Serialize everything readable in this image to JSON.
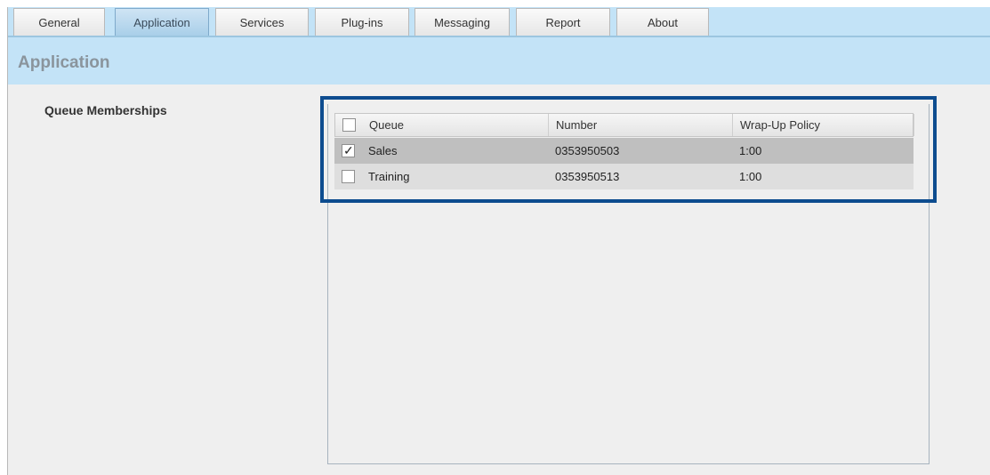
{
  "tabs": [
    {
      "label": "General"
    },
    {
      "label": "Application"
    },
    {
      "label": "Services"
    },
    {
      "label": "Plug-ins"
    },
    {
      "label": "Messaging"
    },
    {
      "label": "Report"
    },
    {
      "label": "About"
    }
  ],
  "active_tab": "Application",
  "header": {
    "title": "Application"
  },
  "queue_section": {
    "label": "Queue Memberships"
  },
  "table": {
    "columns": [
      "Queue",
      "Number",
      "Wrap-Up Policy"
    ],
    "select_all_checked": false,
    "rows": [
      {
        "checked": true,
        "queue": "Sales",
        "number": "0353950503",
        "wrapup": "1:00",
        "check_glyph": "✓"
      },
      {
        "checked": false,
        "queue": "Training",
        "number": "0353950513",
        "wrapup": "1:00",
        "check_glyph": ""
      }
    ]
  },
  "colors": {
    "tabbar_bg": "#c3e3f7",
    "active_tab": "#a9cfe9",
    "highlight_frame": "#0d4c8f",
    "selected_row": "#bfbfbf"
  }
}
